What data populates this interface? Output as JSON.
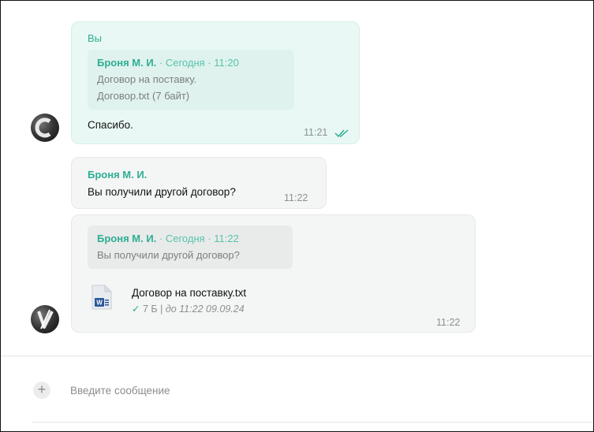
{
  "messages": [
    {
      "sender": "Вы",
      "quote": {
        "name": "Броня М. И.",
        "meta": "· Сегодня · 11:20",
        "lines": [
          "Договор на поставку.",
          "Договор.txt (7 байт)"
        ]
      },
      "text": "Спасибо.",
      "time": "11:21",
      "status_icon": "double-check-icon"
    },
    {
      "sender": "Броня М. И.",
      "text": "Вы получили другой договор?",
      "time": "11:22"
    },
    {
      "quote": {
        "name": "Броня М. И.",
        "meta": "· Сегодня · 11:22",
        "lines": [
          "Вы получили другой договор?"
        ]
      },
      "attachment": {
        "icon": "word-document-icon",
        "name": "Договор на поставку.txt",
        "status_mark": "✓",
        "size": "7 Б",
        "separator": "|",
        "expiry": "до 11:22 09.09.24"
      },
      "time": "11:22"
    }
  ],
  "composer": {
    "placeholder": "Введите сообщение",
    "value": "",
    "add_icon": "plus-icon",
    "add_glyph": "+"
  },
  "colors": {
    "accent": "#2eae92",
    "my_bubble": "#e9f8f4",
    "their_bubble": "#f4f5f5"
  }
}
